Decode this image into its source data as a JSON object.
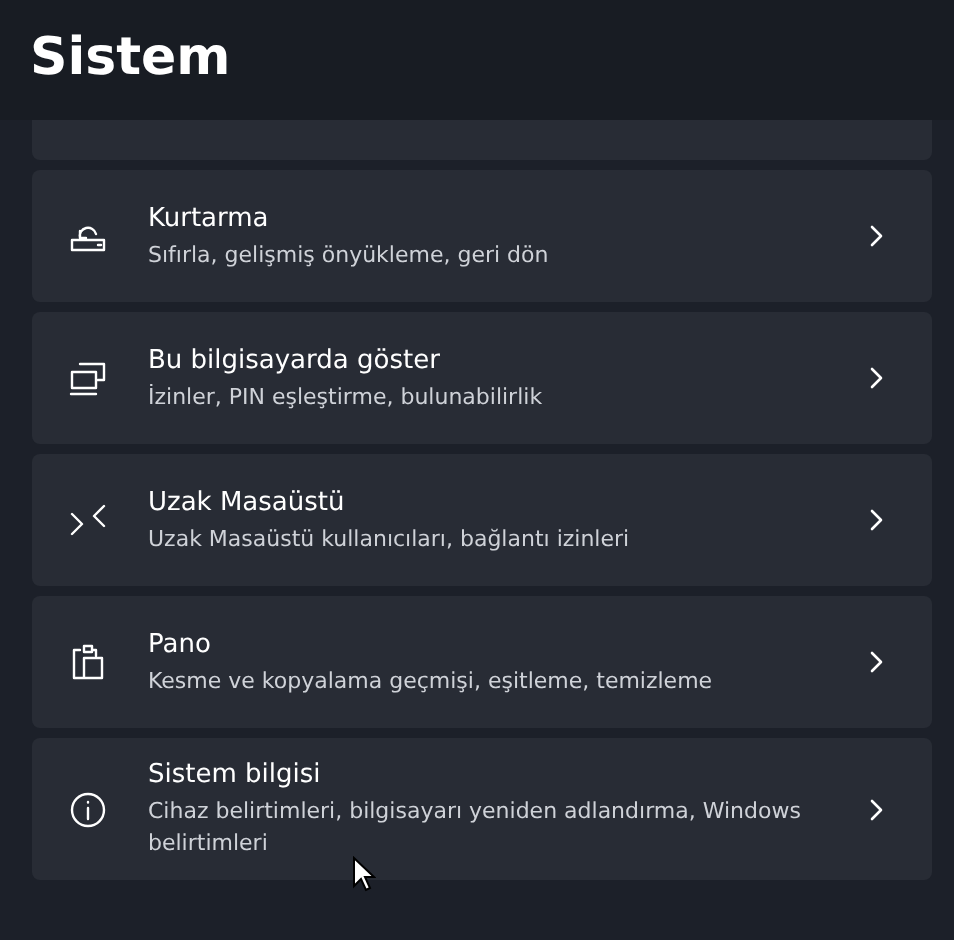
{
  "title": "Sistem",
  "items": [
    {
      "kind": "recovery",
      "title": "Kurtarma",
      "description": "Sıfırla, gelişmiş önyükleme, geri dön"
    },
    {
      "kind": "projecting",
      "title": "Bu bilgisayarda göster",
      "description": "İzinler, PIN eşleştirme, bulunabilirlik"
    },
    {
      "kind": "remote",
      "title": "Uzak Masaüstü",
      "description": "Uzak Masaüstü kullanıcıları, bağlantı izinleri"
    },
    {
      "kind": "clipboard",
      "title": "Pano",
      "description": "Kesme ve kopyalama geçmişi, eşitleme, temizleme"
    },
    {
      "kind": "about",
      "title": "Sistem bilgisi",
      "description": "Cihaz belirtimleri, bilgisayarı yeniden adlandırma, Windows belirtimleri"
    }
  ]
}
